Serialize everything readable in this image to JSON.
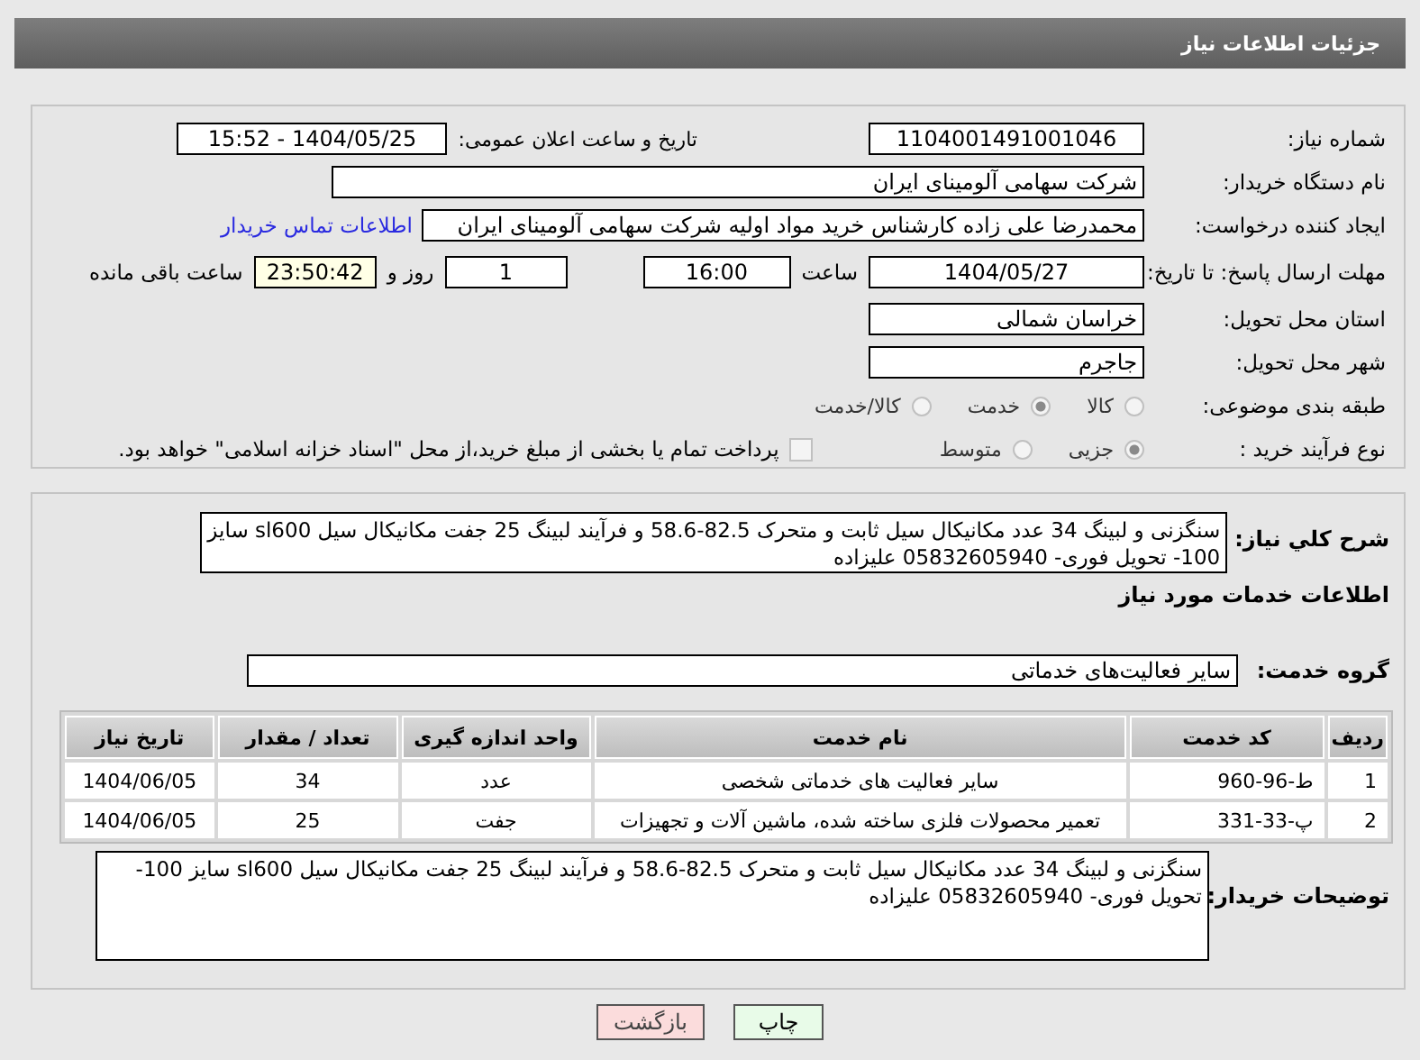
{
  "page_title": "جزئیات اطلاعات نیاز",
  "need_number": {
    "label": "شماره نیاز:",
    "value": "1104001491001046"
  },
  "announce": {
    "label": "تاریخ و ساعت اعلان عمومی:",
    "value": "1404/05/25 - 15:52"
  },
  "buyer": {
    "label": "نام دستگاه خریدار:",
    "value": "شرکت سهامی آلومینای ایران"
  },
  "requester": {
    "label": "ایجاد کننده درخواست:",
    "value": "محمدرضا علی زاده کارشناس خرید مواد اولیه شرکت سهامی آلومینای ایران",
    "link": "اطلاعات تماس خریدار"
  },
  "deadline": {
    "label": "مهلت ارسال پاسخ: تا تاریخ:",
    "date": "1404/05/27",
    "time_label": "ساعت",
    "time": "16:00",
    "days": "1",
    "days_label": "روز و",
    "remaining": "23:50:42",
    "remaining_label": "ساعت باقی مانده"
  },
  "province": {
    "label": "استان محل تحویل:",
    "value": "خراسان شمالی"
  },
  "city": {
    "label": "شهر محل تحویل:",
    "value": "جاجرم"
  },
  "category": {
    "label": "طبقه بندی موضوعی:",
    "options": [
      {
        "label": "کالا",
        "selected": false
      },
      {
        "label": "خدمت",
        "selected": true
      },
      {
        "label": "کالا/خدمت",
        "selected": false
      }
    ]
  },
  "purchase_type": {
    "label": "نوع فرآیند خرید :",
    "options": [
      {
        "label": "جزیی",
        "selected": true
      },
      {
        "label": "متوسط",
        "selected": false
      }
    ],
    "payment": {
      "label": "پرداخت تمام یا بخشی از مبلغ خرید،از محل \"اسناد خزانه اسلامی\" خواهد بود.",
      "checked": false
    }
  },
  "summary": {
    "label": "شرح کلي نياز:",
    "value": "سنگزنی و لبینگ 34 عدد مکانیکال سیل ثابت و متحرک 82.5-58.6 و فرآیند لبینگ 25 جفت مکانیکال سیل sl600 سایز 100- تحویل فوری- 05832605940 علیزاده"
  },
  "services_title": "اطلاعات خدمات مورد نیاز",
  "service_group": {
    "label": "گروه خدمت:",
    "value": "سایر فعالیت‌های خدماتی"
  },
  "table": {
    "columns": [
      "ردیف",
      "کد خدمت",
      "نام خدمت",
      "واحد اندازه گیری",
      "تعداد / مقدار",
      "تاریخ نیاز"
    ],
    "rows": [
      [
        "1",
        "ط-96-960",
        "سایر فعالیت های خدماتی شخصی",
        "عدد",
        "34",
        "1404/06/05"
      ],
      [
        "2",
        "پ-33-331",
        "تعمیر محصولات فلزی ساخته شده، ماشین آلات و تجهیزات",
        "جفت",
        "25",
        "1404/06/05"
      ]
    ]
  },
  "buyer_notes": {
    "label": "توضیحات خریدار:",
    "value": "سنگزنی و لبینگ 34 عدد مکانیکال سیل ثابت و متحرک 82.5-58.6 و فرآیند لبینگ 25 جفت مکانیکال سیل sl600 سایز 100- تحویل فوری- 05832605940 علیزاده"
  },
  "buttons": [
    {
      "label": "چاپ",
      "kind": "print"
    },
    {
      "label": "بازگشت",
      "kind": "back"
    }
  ]
}
